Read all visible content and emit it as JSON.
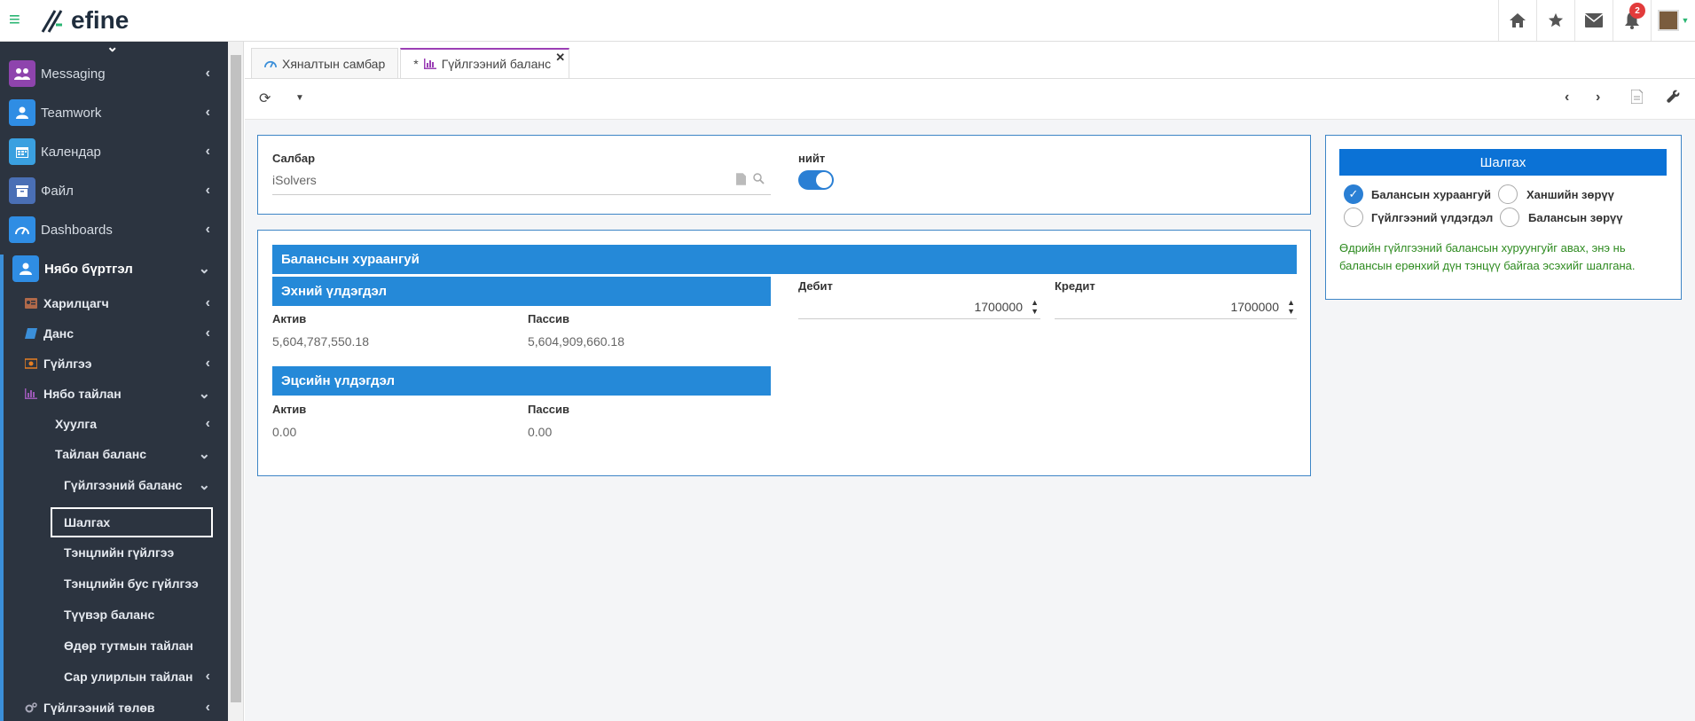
{
  "app": {
    "logo_text": "efine"
  },
  "topbar": {
    "notification_count": "2"
  },
  "sidebar": {
    "items": [
      {
        "label": "Messaging",
        "color": "#8e44ad"
      },
      {
        "label": "Teamwork",
        "color": "#2f8de4"
      },
      {
        "label": "Календар",
        "color": "#3aa0e0"
      },
      {
        "label": "Файл",
        "color": "#4a6fb5"
      },
      {
        "label": "Dashboards",
        "color": "#2f8de4"
      },
      {
        "label": "Нябо бүртгэл",
        "color": "#2f8de4"
      }
    ],
    "sub": {
      "harilcagch": "Харилцагч",
      "dans": "Данс",
      "guilgee": "Гүйлгээ",
      "nyabo_tailan": "Нябо тайлан",
      "huulga": "Хуулга",
      "tailan_balans": "Тайлан баланс",
      "guilgeenii_balans": "Гүйлгээний баланс",
      "shalgah": "Шалгах",
      "tenclin_guilgee": "Тэнцлийн гүйлгээ",
      "tenclin_bus": "Тэнцлийн бус гүйлгээ",
      "tuuver_balans": "Түүвэр баланс",
      "udur_tutmin": "Өдөр тутмын тайлан",
      "sar_ulirlin": "Сар улирлын тайлан",
      "guilgeenii_tuluv": "Гүйлгээний төлөв"
    }
  },
  "tabs": [
    {
      "label": "Хяналтын самбар"
    },
    {
      "prefix": "*",
      "label": "Гүйлгээний баланс"
    }
  ],
  "filter": {
    "branch_label": "Салбар",
    "branch_value": "iSolvers",
    "total_label": "нийт"
  },
  "summary": {
    "title": "Балансын хураангуй",
    "opening": {
      "title": "Эхний үлдэгдэл",
      "asset_label": "Актив",
      "asset_value": "5,604,787,550.18",
      "liability_label": "Пассив",
      "liability_value": "5,604,909,660.18"
    },
    "closing": {
      "title": "Эцсийн үлдэгдэл",
      "asset_label": "Актив",
      "asset_value": "0.00",
      "liability_label": "Пассив",
      "liability_value": "0.00"
    },
    "debit_label": "Дебит",
    "debit_value": "1700000",
    "credit_label": "Кредит",
    "credit_value": "1700000"
  },
  "check": {
    "title": "Шалгах",
    "options": [
      {
        "label": "Балансын хураангуй",
        "checked": true
      },
      {
        "label": "Ханшийн зөрүү",
        "checked": false
      },
      {
        "label": "Гүйлгээний үлдэгдэл",
        "checked": false
      },
      {
        "label": "Балансын зөрүү",
        "checked": false
      }
    ],
    "description": "Өдрийн гүйлгээний балансын хуруунгуйг авах, энэ нь балансын ерөнхий дүн тэнцүү байгаа эсэхийг шалгана."
  }
}
